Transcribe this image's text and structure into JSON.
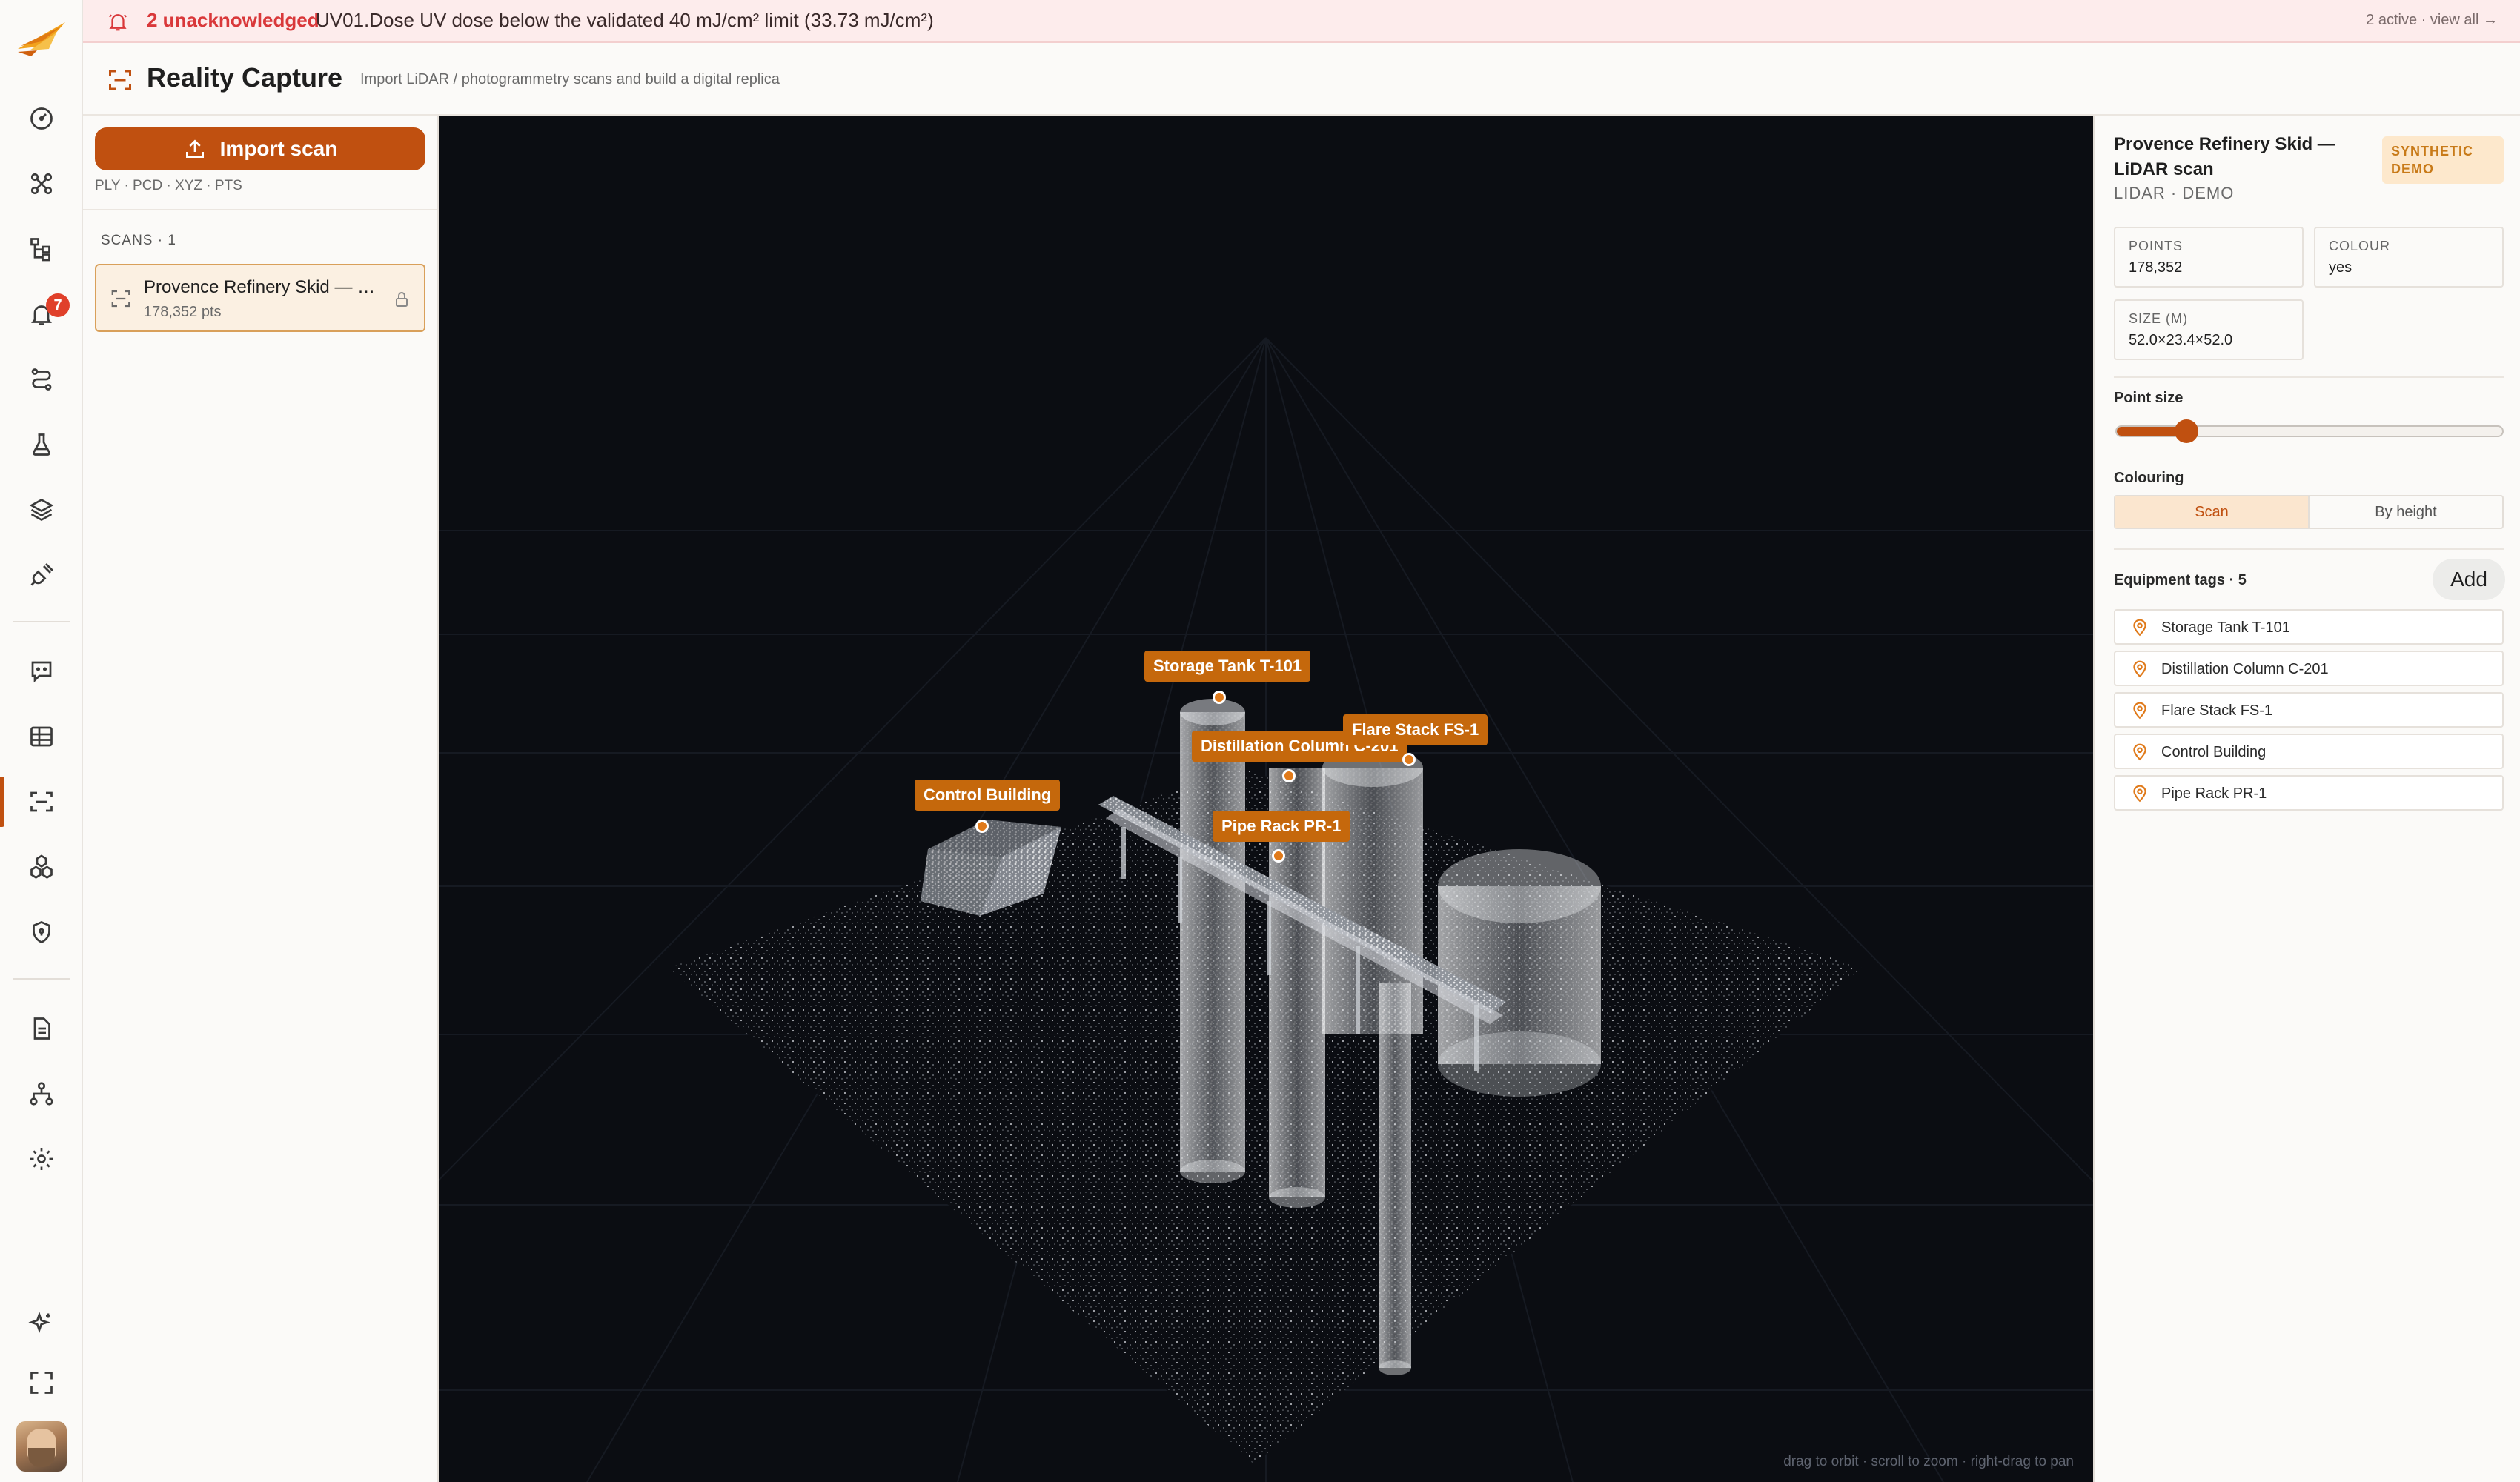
{
  "banner": {
    "unacknowledged": "2 unacknowledged",
    "message": "UV01.Dose UV dose below the validated 40 mJ/cm² limit (33.73 mJ/cm²)",
    "view_all": "2 active · view all →"
  },
  "rail": {
    "notifications_badge": "7",
    "items": [
      "gauge-icon",
      "nodes-icon",
      "hierarchy-icon",
      "bell-icon",
      "route-icon",
      "flask-icon",
      "layers-icon",
      "plug-icon",
      "chat-icon",
      "table-icon",
      "scan-icon",
      "cubes-icon",
      "shield-icon",
      "document-icon",
      "org-chart-icon",
      "gear-icon",
      "sparkle-icon",
      "fullscreen-icon"
    ]
  },
  "header": {
    "title": "Reality Capture",
    "subtitle": "Import LiDAR / photogrammetry scans and build a digital replica"
  },
  "scans_panel": {
    "import_label": "Import scan",
    "formats": "PLY · PCD · XYZ · PTS",
    "count_label": "SCANS · 1",
    "scans": [
      {
        "name": "Provence Refinery Skid — LiDAR scan",
        "points": "178,352 pts"
      }
    ]
  },
  "viewer": {
    "hint": "drag to orbit · scroll to zoom · right-drag to pan",
    "tags": [
      "Storage Tank T-101",
      "Distillation Column C-201",
      "Flare Stack FS-1",
      "Control Building",
      "Pipe Rack PR-1"
    ]
  },
  "inspector": {
    "title": "Provence Refinery Skid — LiDAR scan",
    "subtitle": "LIDAR · DEMO",
    "synthetic_badge": "SYNTHETIC DEMO",
    "stats": {
      "points_label": "POINTS",
      "points_value": "178,352",
      "colour_label": "COLOUR",
      "colour_value": "yes",
      "size_label": "SIZE (M)",
      "size_value": "52.0×23.4×52.0"
    },
    "point_size_label": "Point size",
    "point_size_fraction": 0.18,
    "colouring_label": "Colouring",
    "colouring_options": [
      "Scan",
      "By height"
    ],
    "colouring_selected": "Scan",
    "equipment_label": "Equipment tags · 5",
    "add_label": "Add",
    "equipment": [
      "Storage Tank T-101",
      "Distillation Column C-201",
      "Flare Stack FS-1",
      "Control Building",
      "Pipe Rack PR-1"
    ]
  },
  "colors": {
    "accent": "#c05010",
    "alert": "#d9383a",
    "viewer_bg": "#0b0d12",
    "tag": "#c5680c"
  }
}
